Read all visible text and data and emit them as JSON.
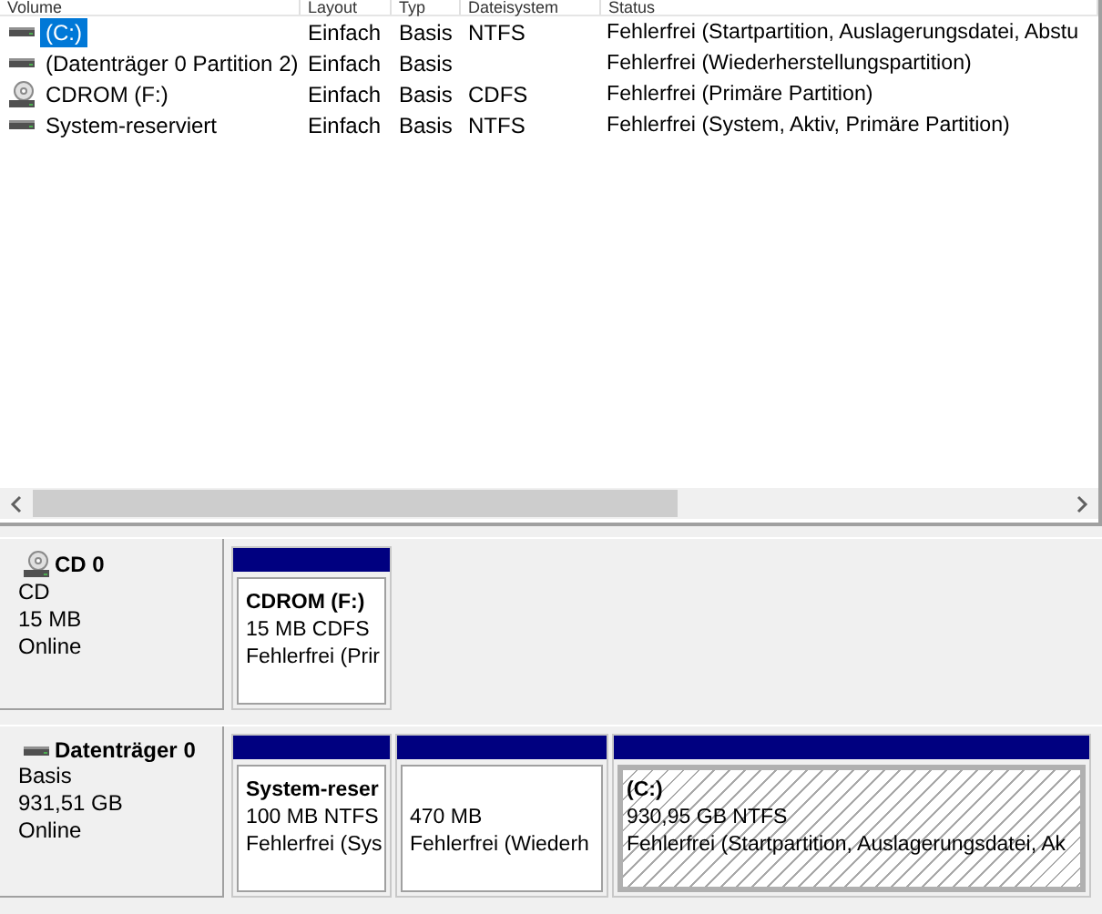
{
  "columns": [
    "Volume",
    "Layout",
    "Typ",
    "Dateisystem",
    "Status"
  ],
  "volumes": [
    {
      "kind": "disk",
      "name": "(C:)",
      "layout": "Einfach",
      "type": "Basis",
      "filesystem": "NTFS",
      "status": "Fehlerfrei (Startpartition, Auslagerungsdatei, Abstu",
      "selected": true
    },
    {
      "kind": "disk",
      "name": "(Datenträger 0 Partition 2)",
      "layout": "Einfach",
      "type": "Basis",
      "status": "Fehlerfrei (Wiederherstellungspartition)",
      "selected": false
    },
    {
      "kind": "cd",
      "name": "CDROM (F:)",
      "layout": "Einfach",
      "type": "Basis",
      "filesystem": "CDFS",
      "status": "Fehlerfrei (Primäre Partition)",
      "selected": false
    },
    {
      "kind": "disk",
      "name": "System-reserviert",
      "layout": "Einfach",
      "type": "Basis",
      "filesystem": "NTFS",
      "status": "Fehlerfrei (System, Aktiv, Primäre Partition)",
      "selected": false
    }
  ],
  "disks": [
    {
      "kind": "cd",
      "name": "CD 0",
      "type": "CD",
      "size": "15 MB",
      "state": "Online",
      "partitions": [
        {
          "label": "CDROM  (F:)",
          "details": "15 MB CDFS",
          "status": "Fehlerfrei (Prir",
          "selected": false
        }
      ]
    },
    {
      "kind": "disk",
      "name": "Datenträger 0",
      "type": "Basis",
      "size": "931,51 GB",
      "state": "Online",
      "partitions": [
        {
          "label": "System-reser",
          "details": "100 MB NTFS",
          "status": "Fehlerfrei (Sys",
          "selected": false
        },
        {
          "details": "470 MB",
          "status": "Fehlerfrei (Wiederh",
          "selected": false
        },
        {
          "label": "(C:)",
          "details": "930,95 GB NTFS",
          "status": "Fehlerfrei (Startpartition, Auslagerungsdatei, Ak",
          "selected": true
        }
      ]
    }
  ]
}
